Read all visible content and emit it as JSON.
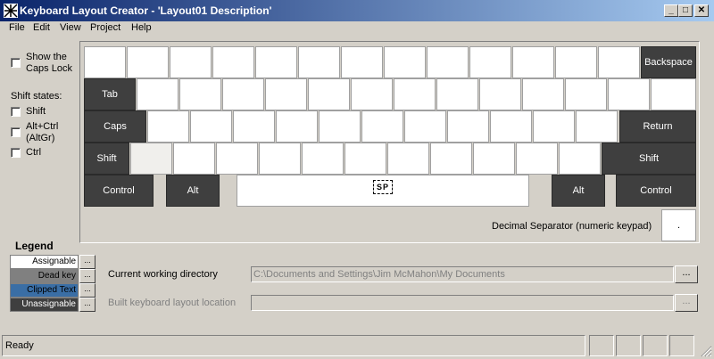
{
  "window": {
    "title": "Keyboard Layout Creator - 'Layout01 Description'",
    "minimize_label": "_",
    "maximize_label": "□",
    "close_label": "✕"
  },
  "menu": {
    "items": [
      {
        "label": "File"
      },
      {
        "label": "Edit"
      },
      {
        "label": "View"
      },
      {
        "label": "Project"
      },
      {
        "label": "Help"
      }
    ]
  },
  "options": {
    "show_caps_lock_line1": "Show the",
    "show_caps_lock_line2": "Caps Lock",
    "shift_states_heading": "Shift states:",
    "shift_label": "Shift",
    "altgr_line1": "Alt+Ctrl",
    "altgr_line2": "(AltGr)",
    "ctrl_label": "Ctrl"
  },
  "keyboard": {
    "backspace": "Backspace",
    "tab": "Tab",
    "caps": "Caps",
    "return": "Return",
    "left_shift": "Shift",
    "right_shift": "Shift",
    "left_control": "Control",
    "left_alt": "Alt",
    "space_marker": "SP",
    "right_alt": "Alt",
    "right_control": "Control",
    "decimal_separator_label": "Decimal Separator (numeric keypad)",
    "decimal_separator_value": "."
  },
  "legend": {
    "heading": "Legend",
    "items": [
      {
        "label": "Assignable",
        "color": "#ffffff",
        "text_color": "#000000"
      },
      {
        "label": "Dead key",
        "color": "#808080",
        "text_color": "#000000"
      },
      {
        "label": "Clipped Text",
        "color": "#3a6ea5",
        "text_color": "#000000"
      },
      {
        "label": "Unassignable",
        "color": "#3f3f3f",
        "text_color": "#ffffff"
      }
    ],
    "button_label": "..."
  },
  "paths": {
    "working_dir_label": "Current working directory",
    "working_dir_value": "C:\\Documents and Settings\\Jim McMahon\\My Documents",
    "build_location_label": "Built keyboard layout location",
    "build_location_value": "",
    "browse_label": "..."
  },
  "status": {
    "text": "Ready"
  }
}
